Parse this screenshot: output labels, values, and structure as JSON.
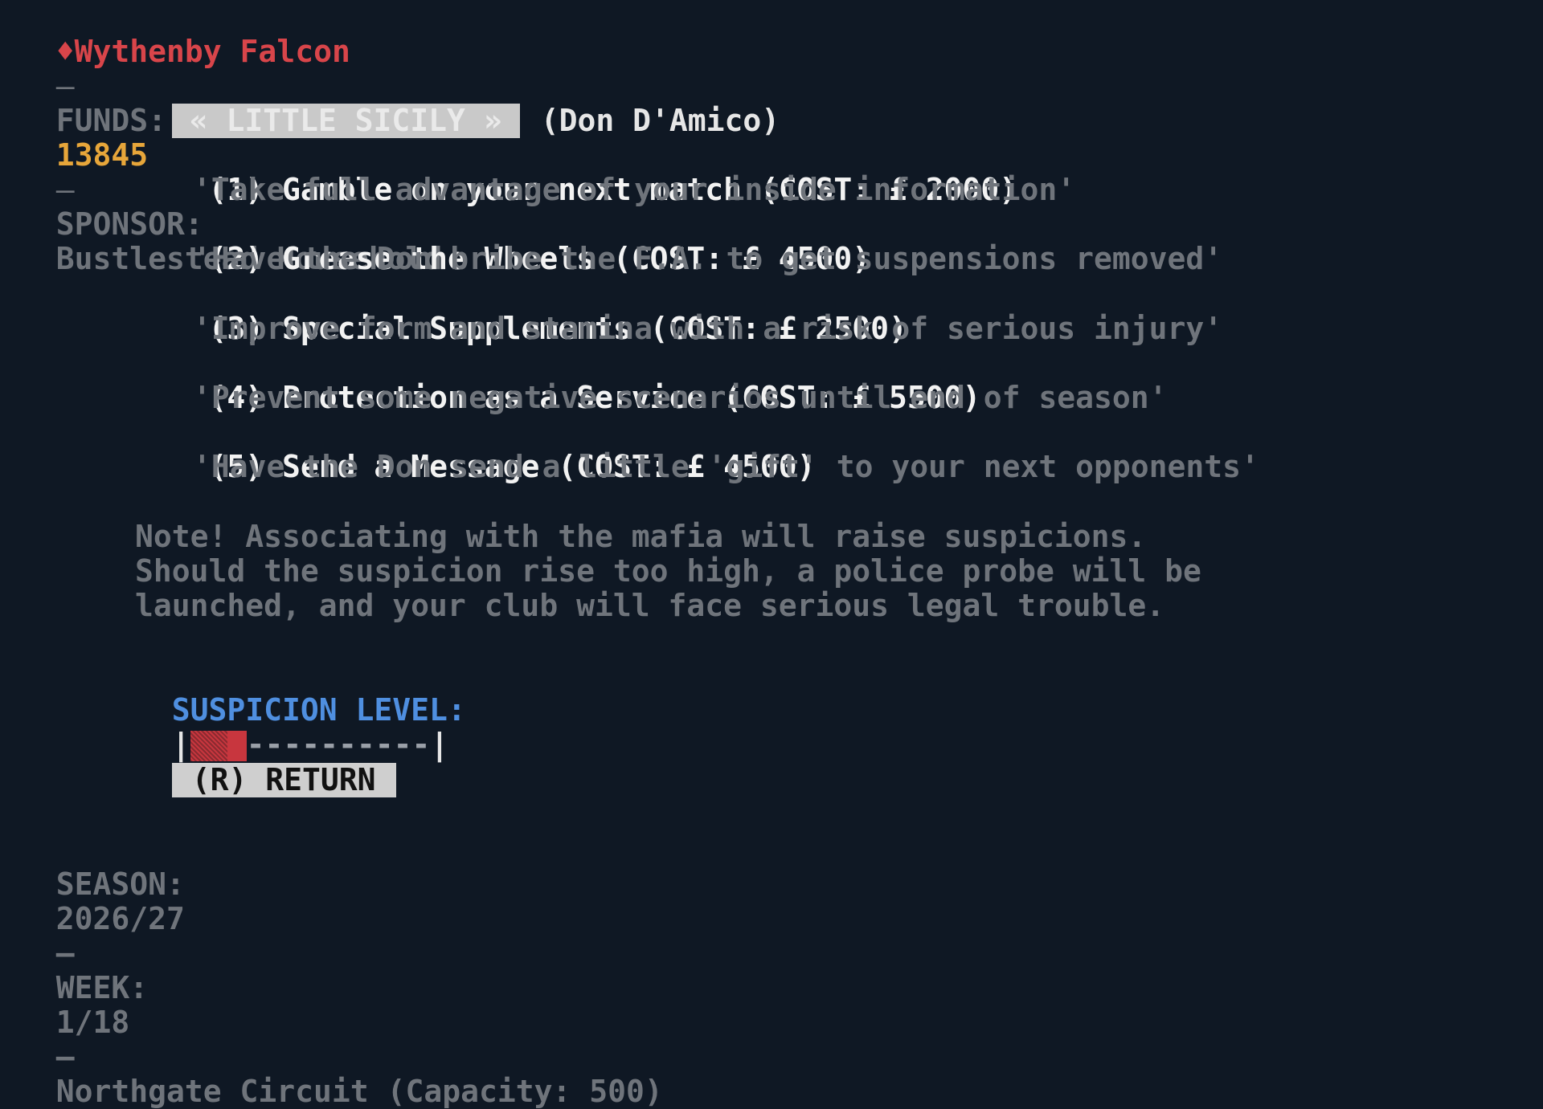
{
  "header": {
    "club_icon": "diamond-icon",
    "club_name": "Wythenby Falcon",
    "separator": "—",
    "funds_label": "FUNDS: £",
    "funds_value": "13845",
    "sponsor_label": "SPONSOR:",
    "sponsor_value": "Bustlestead Household",
    "colors": {
      "club": "#d8454a",
      "funds": "#e7a63a",
      "accent": "#4f8fe0"
    }
  },
  "shop": {
    "tab_label": "« LITTLE SICILY »",
    "owner": "(Don D'Amico)"
  },
  "options": [
    {
      "key": "(1)",
      "title": "Gamble on your next match",
      "cost": "(COST: £ 2000)",
      "description": "'Take full advantage of your inside information'"
    },
    {
      "key": "(2)",
      "title": "Grease the Wheels",
      "cost": "(COST: £ 4500)",
      "description": "'Have the Don bribe the F.A. to get suspensions removed'"
    },
    {
      "key": "(3)",
      "title": "Special Supplements",
      "cost": "(COST: £ 2500)",
      "description": "'Improve form and stamina with a risk of serious injury'"
    },
    {
      "key": "(4)",
      "title": "Protection as a Service",
      "cost": "(COST: £ 5500)",
      "description": "'Prevent some negative scenarios until end of season'"
    },
    {
      "key": "(5)",
      "title": "Send a Message",
      "cost": "(COST: £ 4500)",
      "description": "'Have the Don send a little 'gift' to your next opponents'"
    }
  ],
  "note": {
    "lines": [
      "Note! Associating with the mafia will raise suspicions.",
      "Should the suspicion rise too high, a police probe will be",
      "launched, and your club will face serious legal trouble."
    ]
  },
  "suspicion": {
    "label": "SUSPICION LEVEL:",
    "left_edge": "|",
    "right_edge": "|",
    "level_fraction": 0.28,
    "track": "----------"
  },
  "return_button": {
    "label": "(R) RETURN"
  },
  "footer": {
    "season_label": "SEASON:",
    "season_value": "2026/27",
    "separator": "—",
    "week_label": "WEEK:",
    "week_value": "1/18",
    "stadium": "Northgate Circuit (Capacity: 500)"
  }
}
